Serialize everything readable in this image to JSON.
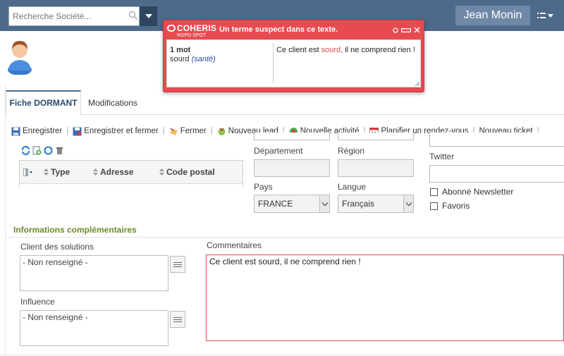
{
  "search": {
    "placeholder": "Recherche Société..."
  },
  "user": {
    "name": "Jean Monin"
  },
  "tabs": [
    {
      "label": "Fiche DORMANT"
    },
    {
      "label": "Modifications"
    }
  ],
  "toolbar": {
    "save": "Enregistrer",
    "save_close": "Enregistrer et fermer",
    "close": "Fermer",
    "new_lead": "Nouveau lead",
    "new_activity": "Nouvelle activité",
    "plan_meeting": "Planifier un rendez-vous",
    "new_ticket": "Nouveau ticket"
  },
  "address_table": {
    "columns": [
      "Type",
      "Adresse",
      "Code postal"
    ]
  },
  "form": {
    "departement_label": "Département",
    "region_label": "Région",
    "pays_label": "Pays",
    "pays_value": "FRANCE",
    "langue_label": "Langue",
    "langue_value": "Français",
    "twitter_label": "Twitter",
    "newsletter_label": "Abonné Newsletter",
    "favoris_label": "Favoris"
  },
  "complementary": {
    "title": "Informations complémentaires",
    "client_solutions_label": "Client des solutions",
    "client_solutions_value": "- Non renseigné -",
    "influence_label": "Influence",
    "influence_value": "- Non renseigné -",
    "comments_label": "Commentaires",
    "comments_value": "Ce client est sourd, il ne comprend rien !"
  },
  "popup": {
    "brand": "COHERIS",
    "brand_sub": "RGPD SPOT",
    "title": "Un terme suspect dans ce texte.",
    "count": "1 mot",
    "term": "sourd",
    "category": "(santé)",
    "context_before": "Ce client est ",
    "context_term": "sourd,",
    "context_after": " il ne comprend rien !"
  },
  "colors": {
    "topbar": "#4d6a8a",
    "popup": "#e74b50",
    "section": "#6a8a2a"
  }
}
